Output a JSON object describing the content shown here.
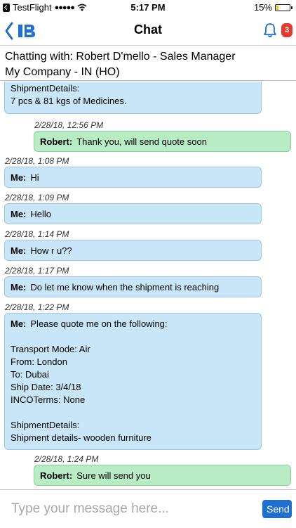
{
  "status_bar": {
    "app": "TestFlight",
    "time": "5:17 PM",
    "battery": "15%",
    "battery_level": 0.15
  },
  "navbar": {
    "title": "Chat",
    "badge_count": "3"
  },
  "chat_header": {
    "line1": "Chatting with: Robert D'mello - Sales Manager",
    "line2": "My Company - IN (HO)"
  },
  "messages": [
    {
      "lines": [
        "ShipmentDetails:",
        "7 pcs & 81 kgs of Medicines."
      ]
    },
    {
      "time": "2/28/18, 12:56 PM",
      "sender": "Robert:",
      "text": "Thank you, will send quote soon"
    },
    {
      "time": "2/28/18, 1:08 PM",
      "sender": "Me:",
      "text": "Hi"
    },
    {
      "time": "2/28/18, 1:09 PM",
      "sender": "Me:",
      "text": "Hello"
    },
    {
      "time": "2/28/18, 1:14 PM",
      "sender": "Me:",
      "text": "How r u??"
    },
    {
      "time": "2/28/18, 1:17 PM",
      "sender": "Me:",
      "text": "Do let me know when the shipment is reaching"
    },
    {
      "time": "2/28/18, 1:22 PM",
      "sender": "Me:",
      "text": "Please quote me on the following:",
      "lines": [
        "",
        "Transport Mode: Air",
        "From: London",
        "To: Dubai",
        "Ship Date: 3/4/18",
        "INCOTerms: None",
        "",
        "ShipmentDetails:",
        "Shipment details- wooden furniture"
      ]
    },
    {
      "time": "2/28/18, 1:24 PM",
      "sender": "Robert:",
      "text": "Sure will send you"
    }
  ],
  "input": {
    "placeholder": "Type your message here...",
    "value": ""
  },
  "send_label": "Send",
  "colors": {
    "me_bubble": "#c8e6f8",
    "robert_bubble": "#b8ecc4",
    "accent": "#1f6fd1",
    "badge": "#e23b2e"
  }
}
